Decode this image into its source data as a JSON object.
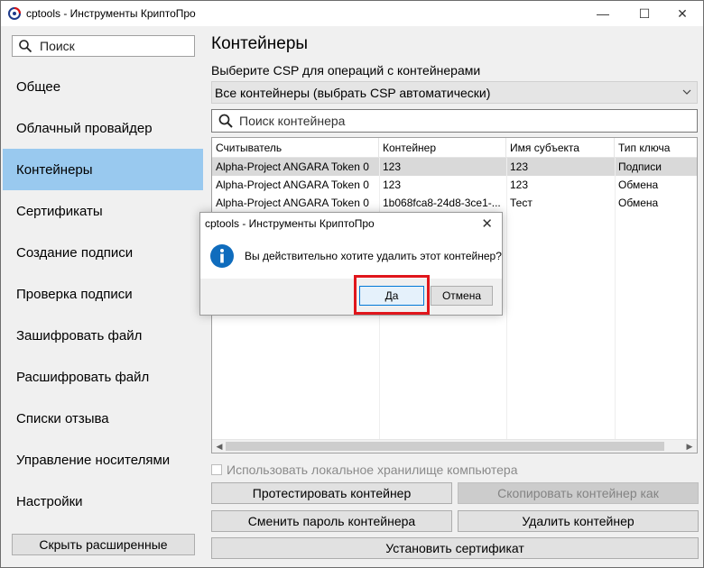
{
  "window": {
    "title": "cptools - Инструменты КриптоПро",
    "controls": {
      "minimize": "—",
      "maximize": "☐",
      "close": "✕"
    }
  },
  "sidebar": {
    "search_placeholder": "Поиск",
    "items": [
      {
        "label": "Общее",
        "active": false
      },
      {
        "label": "Облачный провайдер",
        "active": false
      },
      {
        "label": "Контейнеры",
        "active": true
      },
      {
        "label": "Сертификаты",
        "active": false
      },
      {
        "label": "Создание подписи",
        "active": false
      },
      {
        "label": "Проверка подписи",
        "active": false
      },
      {
        "label": "Зашифровать файл",
        "active": false
      },
      {
        "label": "Расшифровать файл",
        "active": false
      },
      {
        "label": "Списки отзыва",
        "active": false
      },
      {
        "label": "Управление носителями",
        "active": false
      },
      {
        "label": "Настройки",
        "active": false
      }
    ],
    "hide_button": "Скрыть расширенные"
  },
  "main": {
    "title": "Контейнеры",
    "csp_label": "Выберите CSP для операций с контейнерами",
    "csp_selected": "Все контейнеры (выбрать CSP автоматически)",
    "container_search_placeholder": "Поиск контейнера",
    "table": {
      "columns": [
        "Считыватель",
        "Контейнер",
        "Имя субъекта",
        "Тип ключа"
      ],
      "rows": [
        {
          "reader": "Alpha-Project ANGARA Token 0",
          "container": "123",
          "subject": "123",
          "key_type": "Подписи",
          "selected": true
        },
        {
          "reader": "Alpha-Project ANGARA Token 0",
          "container": "123",
          "subject": "123",
          "key_type": "Обмена",
          "selected": false
        },
        {
          "reader": "Alpha-Project ANGARA Token 0",
          "container": "1b068fca8-24d8-3ce1-...",
          "subject": "Тест",
          "key_type": "Обмена",
          "selected": false
        }
      ]
    },
    "local_storage_checkbox": "Использовать локальное хранилище компьютера",
    "buttons": {
      "test": "Протестировать контейнер",
      "copy": "Скопировать контейнер как",
      "change_password": "Сменить пароль контейнера",
      "delete": "Удалить контейнер",
      "install_cert": "Установить сертификат"
    }
  },
  "dialog": {
    "title": "cptools - Инструменты КриптоПро",
    "message": "Вы действительно хотите удалить этот контейнер?",
    "yes": "Да",
    "cancel": "Отмена",
    "close": "✕"
  },
  "colors": {
    "sidebar_active": "#99c9ef",
    "info_icon": "#0f6cbd",
    "highlight": "#e0161c"
  }
}
